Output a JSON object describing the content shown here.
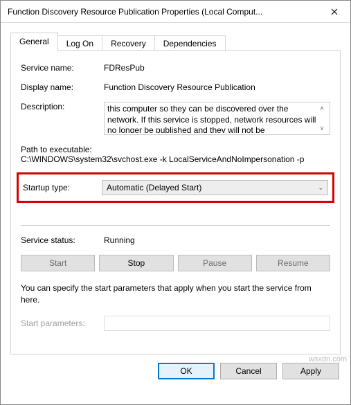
{
  "window": {
    "title": "Function Discovery Resource Publication Properties (Local Comput..."
  },
  "tabs": {
    "general": "General",
    "logon": "Log On",
    "recovery": "Recovery",
    "dependencies": "Dependencies"
  },
  "general": {
    "service_name_label": "Service name:",
    "service_name_value": "FDResPub",
    "display_name_label": "Display name:",
    "display_name_value": "Function Discovery Resource Publication",
    "description_label": "Description:",
    "description_value": "this computer so they can be discovered over the network.  If this service is stopped, network resources will no longer be published and they will not be",
    "path_label": "Path to executable:",
    "path_value": "C:\\WINDOWS\\system32\\svchost.exe -k LocalServiceAndNoImpersonation -p",
    "startup_type_label": "Startup type:",
    "startup_type_value": "Automatic (Delayed Start)",
    "service_status_label": "Service status:",
    "service_status_value": "Running",
    "btn_start": "Start",
    "btn_stop": "Stop",
    "btn_pause": "Pause",
    "btn_resume": "Resume",
    "note": "You can specify the start parameters that apply when you start the service from here.",
    "start_params_label": "Start parameters:"
  },
  "buttons": {
    "ok": "OK",
    "cancel": "Cancel",
    "apply": "Apply"
  },
  "watermark": "wsxdn.com"
}
